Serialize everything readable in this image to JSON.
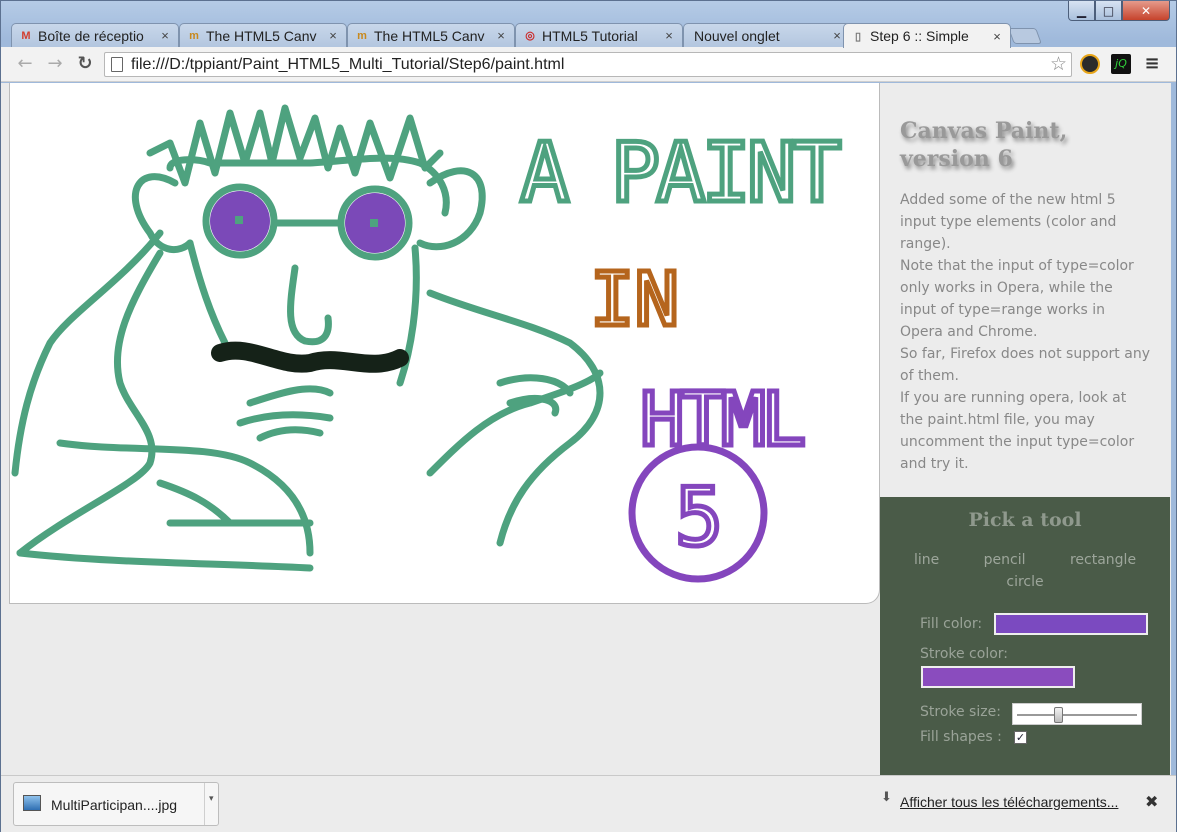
{
  "browser": {
    "tabs": [
      {
        "label": "Boîte de réceptio",
        "icon": "gmail-icon",
        "color": "#d23f31"
      },
      {
        "label": "The HTML5 Canv",
        "icon": "html5-tutorial-icon",
        "color": "#c8891e"
      },
      {
        "label": "The HTML5 Canv",
        "icon": "html5-tutorial-icon",
        "color": "#c8891e"
      },
      {
        "label": "HTML5 Tutorial",
        "icon": "opera-icon",
        "color": "#cc2b2b"
      },
      {
        "label": "Nouvel onglet",
        "icon": "none"
      },
      {
        "label": "Step 6 :: Simple",
        "icon": "page-icon",
        "active": true
      }
    ],
    "close_glyph": "×",
    "address": "file:///D:/tppiant/Paint_HTML5_Multi_Tutorial/Step6/paint.html",
    "nav": {
      "back": "←",
      "forward": "→",
      "reload": "↻",
      "bookmark_star": "☆",
      "menu": "≡"
    }
  },
  "window_controls": {
    "minimize": "▁",
    "maximize": "□",
    "close": "✕"
  },
  "sidebar": {
    "title": "Canvas Paint, version 6",
    "description": [
      "Added some of the new html 5 input type elements (color and range).",
      "Note that the input of type=color only works in Opera, while the input of type=range works in Opera and Chrome.",
      "So far, Firefox does not support any of them.",
      "If you are running opera, look at the paint.html file, you may uncomment the input type=color and try it."
    ]
  },
  "tools": {
    "heading": "Pick a tool",
    "items": [
      "line",
      "pencil",
      "rectangle",
      "circle"
    ],
    "fill_color_label": "Fill color:",
    "stroke_color_label": "Stroke color:",
    "stroke_size_label": "Stroke size:",
    "fill_shapes_label": "Fill shapes :",
    "fill_color": "#7b4ac0",
    "stroke_color": "#8a4cbe",
    "stroke_size_fraction": 0.35,
    "fill_shapes_checked": true,
    "check_glyph": "✓"
  },
  "drawing": {
    "text_a_paint": "A PAINT",
    "text_in": "IN",
    "text_html": "HTML",
    "text_5": "5",
    "colors": {
      "green": "#4ea27f",
      "purple": "#8446bd",
      "orange": "#b5651d",
      "black": "#152218",
      "eye": "#7b49b8"
    }
  },
  "downloads": {
    "file_name": "MultiParticipan....jpg",
    "dropdown_glyph": "▾",
    "show_all": "Afficher tous les téléchargements...",
    "download_glyph": "⬇",
    "close": "✖"
  }
}
